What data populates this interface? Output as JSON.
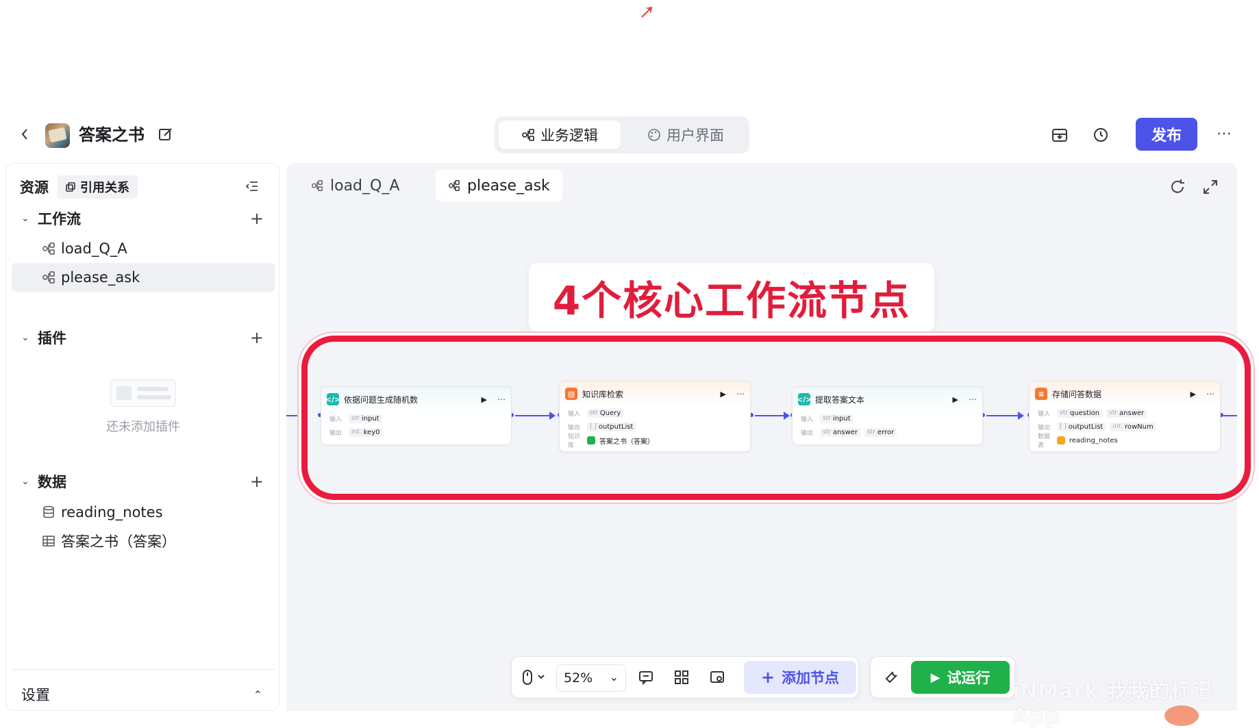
{
  "header": {
    "app_title": "答案之书",
    "tabs": [
      {
        "label": "业务逻辑",
        "active": true
      },
      {
        "label": "用户界面",
        "active": false
      }
    ],
    "publish_label": "发布",
    "accent_color": "#4d53e8"
  },
  "sidebar": {
    "title": "资源",
    "ref_label": "引用关系",
    "sections": {
      "workflow": {
        "label": "工作流",
        "items": [
          "load_Q_A",
          "please_ask"
        ],
        "selected": "please_ask"
      },
      "plugins": {
        "label": "插件",
        "empty_text": "还未添加插件"
      },
      "data": {
        "label": "数据",
        "items": [
          "reading_notes",
          "答案之书（答案）"
        ]
      }
    },
    "settings_label": "设置"
  },
  "canvas": {
    "tabs": [
      {
        "label": "load_Q_A",
        "active": false
      },
      {
        "label": "please_ask",
        "active": true
      }
    ],
    "callout": "4个核心工作流节点",
    "nodes": [
      {
        "title": "依据问题生成随机数",
        "icon": "code-icon",
        "rows": [
          {
            "k": "输入",
            "type": "str",
            "value": "input"
          },
          {
            "k": "输出",
            "type": "int.",
            "value": "key0"
          }
        ]
      },
      {
        "title": "知识库检索",
        "icon": "knowledge-icon",
        "rows": [
          {
            "k": "输入",
            "type": "str",
            "value": "Query"
          },
          {
            "k": "输出",
            "type": "[ ]",
            "value": "outputList"
          },
          {
            "k": "知识库",
            "type": "",
            "value": "答案之书（答案）"
          }
        ]
      },
      {
        "title": "提取答案文本",
        "icon": "code-icon",
        "rows": [
          {
            "k": "输入",
            "type": "str",
            "value": "input"
          },
          {
            "k": "输出",
            "type": "str",
            "value": "answer",
            "type2": "str",
            "value2": "error"
          }
        ]
      },
      {
        "title": "存储问答数据",
        "icon": "database-icon",
        "rows": [
          {
            "k": "输入",
            "type": "str",
            "value": "question",
            "type2": "str",
            "value2": "answer"
          },
          {
            "k": "输出",
            "type": "[ ]",
            "value": "outputList",
            "type2": "int.",
            "value2": "rowNum"
          },
          {
            "k": "数据表",
            "type": "",
            "value": "reading_notes"
          }
        ]
      }
    ]
  },
  "toolbar": {
    "zoom": "52%",
    "add_node_label": "添加节点",
    "trial_run_label": "试运行"
  },
  "watermark": "iNMark 我我的标记App"
}
